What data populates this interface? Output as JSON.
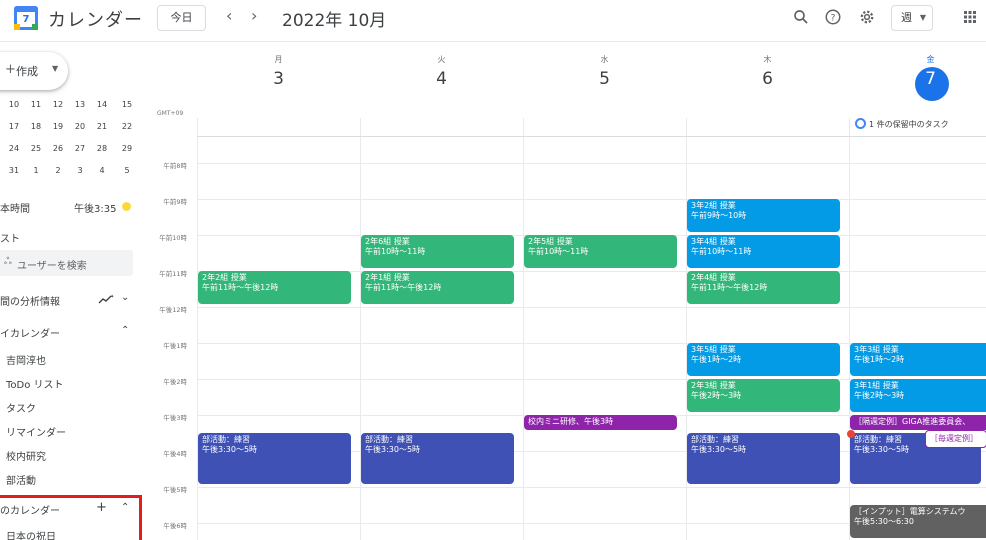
{
  "header": {
    "app_title": "カレンダー",
    "logo_day": "7",
    "today_button": "今日",
    "prev": "‹",
    "next": "›",
    "month_title": "2022年 10月",
    "view_select": "週",
    "icons": [
      "search-icon",
      "help-icon",
      "settings-icon",
      "apps-grid-icon"
    ]
  },
  "sidebar": {
    "create_label": "作成",
    "mini_calendar_rows": [
      [
        "10",
        "11",
        "12",
        "13",
        "14",
        "15"
      ],
      [
        "17",
        "18",
        "19",
        "20",
        "21",
        "22"
      ],
      [
        "24",
        "25",
        "26",
        "27",
        "28",
        "29"
      ],
      [
        "31",
        "1",
        "2",
        "3",
        "4",
        "5"
      ]
    ],
    "timezone_label": "本時間",
    "timezone_time": "午後3:35",
    "list_label": "スト",
    "user_search_placeholder": "ユーザーを検索",
    "analytics_label": "間の分析情報",
    "my_calendars_label": "イカレンダー",
    "my_calendars": [
      "吉岡淳也",
      "ToDo リスト",
      "タスク",
      "リマインダー",
      "校内研究",
      "部活動"
    ],
    "other_calendars_label": "のカレンダー",
    "other_calendars": [
      "日本の祝日"
    ]
  },
  "week": {
    "gmt": "GMT+09",
    "days": [
      {
        "dow": "月",
        "num": "3"
      },
      {
        "dow": "火",
        "num": "4"
      },
      {
        "dow": "水",
        "num": "5"
      },
      {
        "dow": "木",
        "num": "6"
      },
      {
        "dow": "金",
        "num": "7"
      }
    ],
    "time_labels": [
      "午前8時",
      "午前9時",
      "午前10時",
      "午前11時",
      "午後12時",
      "午後1時",
      "午後2時",
      "午後3時",
      "午後4時",
      "午後5時",
      "午後6時"
    ],
    "pending_tasks": "1 件の保留中のタスク",
    "events": {
      "mon_1": {
        "title": "2年2組 授業",
        "time": "午前11時～午後12時"
      },
      "mon_2": {
        "title": "部活動：練習",
        "time": "午後3:30～5時"
      },
      "tue_1": {
        "title": "2年6組 授業",
        "time": "午前10時～11時"
      },
      "tue_2": {
        "title": "2年1組 授業",
        "time": "午前11時～午後12時"
      },
      "tue_3": {
        "title": "部活動：練習",
        "time": "午後3:30～5時"
      },
      "wed_1": {
        "title": "2年5組 授業",
        "time": "午前10時～11時"
      },
      "wed_2": {
        "title": "校内ミニ研修、午後3時"
      },
      "thu_1": {
        "title": "3年2組 授業",
        "time": "午前9時～10時"
      },
      "thu_2": {
        "title": "3年4組 授業",
        "time": "午前10時～11時"
      },
      "thu_3": {
        "title": "2年4組 授業",
        "time": "午前11時～午後12時"
      },
      "thu_4": {
        "title": "3年5組 授業",
        "time": "午後1時～2時"
      },
      "thu_5": {
        "title": "2年3組 授業",
        "time": "午後2時～3時"
      },
      "thu_6": {
        "title": "部活動：練習",
        "time": "午後3:30～5時"
      },
      "fri_1": {
        "title": "3年3組 授業",
        "time": "午後1時～2時"
      },
      "fri_2": {
        "title": "3年1組 授業",
        "time": "午後2時～3時"
      },
      "fri_3": {
        "title": "［隔週定例］GIGA推進委員会、"
      },
      "fri_4": {
        "title": "部活動：練習",
        "time": "午後3:30～5時"
      },
      "fri_5": {
        "title": "［毎週定例］"
      },
      "fri_6": {
        "title": "［インプット］電算システムウ",
        "time": "午後5:30～6:30"
      }
    },
    "colors": {
      "green": "#33b679",
      "blue": "#039be5",
      "indigo": "#3f51b5",
      "purple": "#8e24aa",
      "gray": "#616161",
      "today": "#1a73e8"
    }
  }
}
